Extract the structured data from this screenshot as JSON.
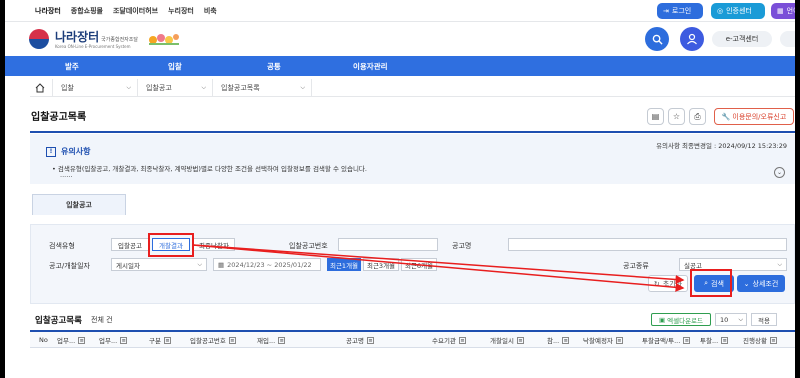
{
  "topbar": {
    "sites": [
      "나라장터",
      "종합쇼핑몰",
      "조달데이터허브",
      "누리장터",
      "비축"
    ],
    "login": "로그인",
    "cert": "인증센터",
    "lang": "언어"
  },
  "header": {
    "logo_title": "나라장터",
    "logo_tag": "국가종합전자조달",
    "logo_sub": "Korea ON-Line E-Procurement System",
    "ecenter": "e-고객센터"
  },
  "nav": [
    "발주",
    "입찰",
    "공통",
    "이용자관리"
  ],
  "breadcrumb": [
    "입찰",
    "입찰공고",
    "입찰공고목록"
  ],
  "page": {
    "title": "입찰공고목록",
    "report": "이용문의/오류신고"
  },
  "notice": {
    "heading": "유의사항",
    "date": "유의사항 최종변경일 : 2024/09/12 15:23:29",
    "line1": "• 검색유형(입찰공고, 개찰결과, 최종낙찰자, 계약방법)별로 다양한 조건을 선택하여 입찰정보를 검색할 수 있습니다.",
    "line2": "......"
  },
  "tab": "입찰공고",
  "search": {
    "type_label": "검색유형",
    "types": [
      "입찰공고",
      "개찰결과",
      "최종낙찰자"
    ],
    "notice_no_label": "입찰공고번호",
    "notice_name_label": "공고명",
    "date_label": "공고/개찰일자",
    "date_type": "게시일자",
    "date_range": "2024/12/23 ~ 2025/01/22",
    "periods": [
      "최근1개월",
      "최근3개월",
      "최근6개월"
    ],
    "kind_label": "공고종류",
    "kind_value": "실공고",
    "reset": "초기화",
    "search": "검색",
    "detail": "상세조건"
  },
  "list": {
    "title": "입찰공고목록",
    "count": "전체 건",
    "excel": "엑셀다운로드",
    "page_size": "10",
    "apply": "적용",
    "columns": [
      "No",
      "업무...",
      "업무...",
      "구분",
      "입찰공고번호",
      "재입...",
      "공고명",
      "수요기관",
      "개찰일시",
      "참...",
      "낙찰예정자",
      "투찰금액/투...",
      "투찰...",
      "진행상황"
    ]
  },
  "colors": {
    "primary": "#2d6ddd",
    "nav": "#2f6fe0",
    "highlight": "#e81e1e"
  }
}
